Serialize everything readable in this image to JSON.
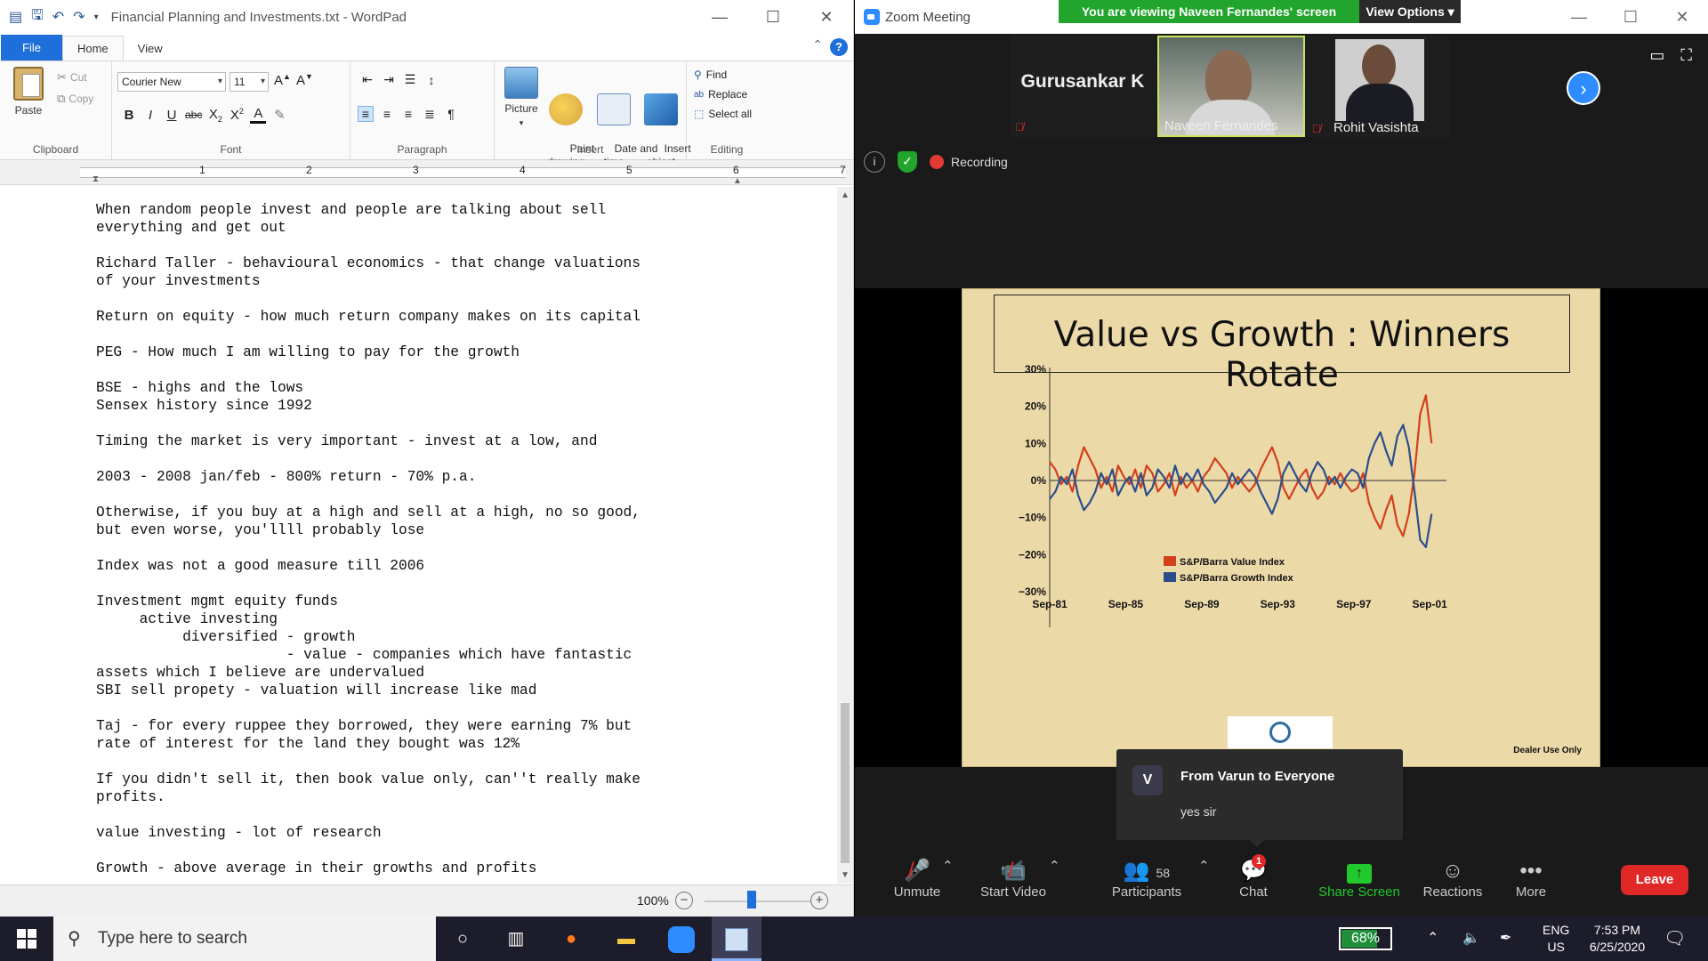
{
  "wordpad": {
    "title": "Financial Planning and Investments.txt - WordPad",
    "tabs": [
      "File",
      "Home",
      "View"
    ],
    "clipboard": {
      "paste": "Paste",
      "cut": "Cut",
      "copy": "Copy",
      "label": "Clipboard"
    },
    "font": {
      "family": "Courier New",
      "size": "11",
      "label": "Font"
    },
    "paragraph_label": "Paragraph",
    "insert": {
      "picture": "Picture",
      "paint": "Paint\ndrawing",
      "datetime": "Date and\ntime",
      "object": "Insert\nobject",
      "label": "Insert"
    },
    "editing": {
      "find": "Find",
      "replace": "Replace",
      "select_all": "Select all",
      "label": "Editing"
    },
    "ruler_numbers": [
      "1",
      "2",
      "3",
      "4",
      "5",
      "6",
      "7"
    ],
    "document_text": "When random people invest and people are talking about sell\neverything and get out\n\nRichard Taller - behavioural economics - that change valuations\nof your investments\n\nReturn on equity - how much return company makes on its capital\n\nPEG - How much I am willing to pay for the growth\n\nBSE - highs and the lows\nSensex history since 1992\n\nTiming the market is very important - invest at a low, and\n\n2003 - 2008 jan/feb - 800% return - 70% p.a.\n\nOtherwise, if you buy at a high and sell at a high, no so good,\nbut even worse, you'llll probably lose\n\nIndex was not a good measure till 2006\n\nInvestment mgmt equity funds\n     active investing\n          diversified - growth\n                      - value - companies which have fantastic\nassets which I believe are undervalued\nSBI sell propety - valuation will increase like mad\n\nTaj - for every ruppee they borrowed, they were earning 7% but\nrate of interest for the land they bought was 12%\n\nIf you didn't sell it, then book value only, can''t really make\nprofits.\n\nvalue investing - lot of research\n\nGrowth - above average in their growths and profits",
    "zoom": "100%"
  },
  "zoom_app": {
    "title": "Zoom Meeting",
    "banner": "You are viewing Naveen Fernandes' screen",
    "view_options": "View Options",
    "participants": [
      {
        "name": "Gurusankar K"
      },
      {
        "name": "Naveen Fernandes"
      },
      {
        "name": "Rohit Vasishta"
      }
    ],
    "recording": "Recording",
    "slide_title": "Value vs Growth : Winners Rotate",
    "dealer_note": "Dealer Use Only",
    "chat": {
      "avatar": "V",
      "from": "From Varun to Everyone",
      "message": "yes sir"
    },
    "toolbar": {
      "unmute": "Unmute",
      "start_video": "Start Video",
      "participants": "Participants",
      "participant_count": "58",
      "chat": "Chat",
      "chat_badge": "1",
      "share": "Share Screen",
      "reactions": "Reactions",
      "more": "More",
      "leave": "Leave"
    }
  },
  "chart_data": {
    "type": "line",
    "title": "Value vs Growth : Winners Rotate",
    "x_ticks": [
      "Sep-81",
      "Sep-85",
      "Sep-89",
      "Sep-93",
      "Sep-97",
      "Sep-01"
    ],
    "y_ticks": [
      "30%",
      "20%",
      "10%",
      "0%",
      "−10%",
      "−20%",
      "−30%"
    ],
    "ylim": [
      -30,
      30
    ],
    "xlim": [
      1981.7,
      2002.3
    ],
    "legend_position": "bottom-center",
    "series": [
      {
        "name": "S&P/Barra Value Index",
        "color": "#d2401c",
        "x": [
          1981.7,
          1982.0,
          1982.3,
          1982.6,
          1982.9,
          1983.2,
          1983.5,
          1983.8,
          1984.1,
          1984.4,
          1984.7,
          1985.0,
          1985.3,
          1985.6,
          1985.9,
          1986.2,
          1986.5,
          1986.8,
          1987.1,
          1987.4,
          1987.7,
          1988.0,
          1988.3,
          1988.6,
          1988.9,
          1989.2,
          1989.5,
          1989.8,
          1990.1,
          1990.4,
          1990.7,
          1991.0,
          1991.3,
          1991.6,
          1991.9,
          1992.2,
          1992.5,
          1992.8,
          1993.1,
          1993.4,
          1993.7,
          1994.0,
          1994.3,
          1994.6,
          1994.9,
          1995.2,
          1995.5,
          1995.8,
          1996.1,
          1996.4,
          1996.7,
          1997.0,
          1997.3,
          1997.6,
          1997.9,
          1998.2,
          1998.5,
          1998.8,
          1999.1,
          1999.4,
          1999.7,
          2000.0,
          2000.3,
          2000.6,
          2000.9,
          2001.2,
          2001.5,
          2001.8
        ],
        "y": [
          5,
          3,
          -1,
          1,
          -3,
          4,
          9,
          6,
          3,
          -2,
          1,
          -3,
          4,
          1,
          -1,
          3,
          -2,
          4,
          2,
          -3,
          -1,
          2,
          -4,
          1,
          -2,
          0,
          -3,
          1,
          3,
          6,
          4,
          2,
          -2,
          1,
          -1,
          -3,
          -1,
          3,
          6,
          9,
          5,
          -2,
          -5,
          -2,
          1,
          3,
          -2,
          -5,
          -3,
          1,
          -1,
          2,
          -1,
          -3,
          -2,
          2,
          -6,
          -10,
          -13,
          -8,
          -4,
          -12,
          -15,
          -9,
          2,
          18,
          23,
          10
        ]
      },
      {
        "name": "S&P/Barra Growth Index",
        "color": "#2b4e8a",
        "x": [
          1981.7,
          1982.0,
          1982.3,
          1982.6,
          1982.9,
          1983.2,
          1983.5,
          1983.8,
          1984.1,
          1984.4,
          1984.7,
          1985.0,
          1985.3,
          1985.6,
          1985.9,
          1986.2,
          1986.5,
          1986.8,
          1987.1,
          1987.4,
          1987.7,
          1988.0,
          1988.3,
          1988.6,
          1988.9,
          1989.2,
          1989.5,
          1989.8,
          1990.1,
          1990.4,
          1990.7,
          1991.0,
          1991.3,
          1991.6,
          1991.9,
          1992.2,
          1992.5,
          1992.8,
          1993.1,
          1993.4,
          1993.7,
          1994.0,
          1994.3,
          1994.6,
          1994.9,
          1995.2,
          1995.5,
          1995.8,
          1996.1,
          1996.4,
          1996.7,
          1997.0,
          1997.3,
          1997.6,
          1997.9,
          1998.2,
          1998.5,
          1998.8,
          1999.1,
          1999.4,
          1999.7,
          2000.0,
          2000.3,
          2000.6,
          2000.9,
          2001.2,
          2001.5,
          2001.8
        ],
        "y": [
          -5,
          -3,
          1,
          -1,
          3,
          -4,
          -8,
          -6,
          -3,
          2,
          -1,
          3,
          -4,
          -1,
          1,
          -3,
          2,
          -4,
          -2,
          3,
          1,
          -2,
          4,
          -1,
          2,
          0,
          3,
          -1,
          -3,
          -6,
          -4,
          -2,
          2,
          -1,
          1,
          3,
          1,
          -3,
          -6,
          -9,
          -5,
          2,
          5,
          2,
          -1,
          -3,
          2,
          5,
          3,
          -1,
          1,
          -2,
          1,
          3,
          2,
          -2,
          6,
          10,
          13,
          8,
          4,
          12,
          15,
          9,
          -3,
          -16,
          -18,
          -9
        ]
      }
    ]
  },
  "taskbar": {
    "search_placeholder": "Type here to search",
    "battery": "68%",
    "lang_1": "ENG",
    "lang_2": "US",
    "time": "7:53 PM",
    "date": "6/25/2020"
  }
}
